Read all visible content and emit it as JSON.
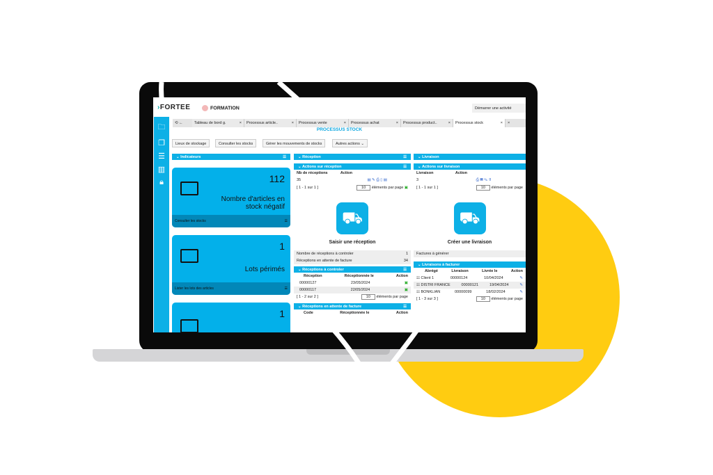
{
  "app": {
    "logo": "FORTEE",
    "company": "FORMATION",
    "start_activity": "Démarrer une activité",
    "page_title": "PROCESSUS STOCK"
  },
  "tabs": [
    "Tableau de bord g.",
    "Processus article..",
    "Processus vente",
    "Processus achat",
    "Processus product..",
    "Processus stock"
  ],
  "toolbar": [
    "Lieux de stockage",
    "Consulter les stocks",
    "Gérer les mouvements de stocks",
    "Autres actions"
  ],
  "indicators": {
    "title": "Indicateurs",
    "cards": [
      {
        "value": "112",
        "label": "Nombre d'articles en stock négatif",
        "footer": "Consulter les stocks",
        "icon": "download-box-icon"
      },
      {
        "value": "1",
        "label": "Lots périmés",
        "footer": "Lister les lots des articles",
        "icon": "archive-box-icon"
      },
      {
        "value": "1",
        "label": "",
        "footer": "",
        "icon": "archive-box-icon"
      }
    ]
  },
  "reception": {
    "title": "Réception",
    "actions_title": "Actions sur réception",
    "col_nb": "Nb de réceptions",
    "col_action": "Action",
    "nb": "35",
    "pager": "[ 1 - 1 sur 1 ]",
    "per_page": "10",
    "per_page_label": "éléments par page",
    "big_button": "Saisir une réception",
    "stats": [
      [
        "Nombre de réceptions à controler",
        "1"
      ],
      [
        "Réceptions en attente de facture",
        "34"
      ]
    ],
    "to_check": {
      "title": "Réceptions à controler",
      "headers": [
        "Réception",
        "Réceptionnée le",
        "Action"
      ],
      "rows": [
        [
          "00000127",
          "23/05/2024"
        ],
        [
          "00000117",
          "22/05/2024"
        ]
      ],
      "pager": "[ 1 - 2 sur 2 ]"
    },
    "awaiting": {
      "title": "Réceptions en attente de facture",
      "headers": [
        "Code",
        "Réceptionnée le",
        "Action"
      ]
    }
  },
  "delivery": {
    "title": "Livraison",
    "actions_title": "Actions sur livraison",
    "col_liv": "Livraison",
    "col_action": "Action",
    "nb": "3",
    "pager": "[ 1 - 1 sur 1 ]",
    "per_page": "10",
    "per_page_label": "éléments par page",
    "big_button": "Créer une livraison",
    "invoices": "Factures à générer",
    "to_invoice": {
      "title": "Livraisons à facturer",
      "headers": [
        "Abrégé",
        "Livraison",
        "Livrée le",
        "Action"
      ],
      "rows": [
        [
          "Client 1",
          "00000124",
          "10/04/2024"
        ],
        [
          "DISTRI FRANCE",
          "00000121",
          "19/04/2024"
        ],
        [
          "BONKLIAN",
          "00000099",
          "18/02/2024"
        ]
      ],
      "pager": "[ 1 - 3 sur 3 ]"
    }
  },
  "colors": {
    "accent": "#0db0e6",
    "yellow": "#ffcc11"
  }
}
